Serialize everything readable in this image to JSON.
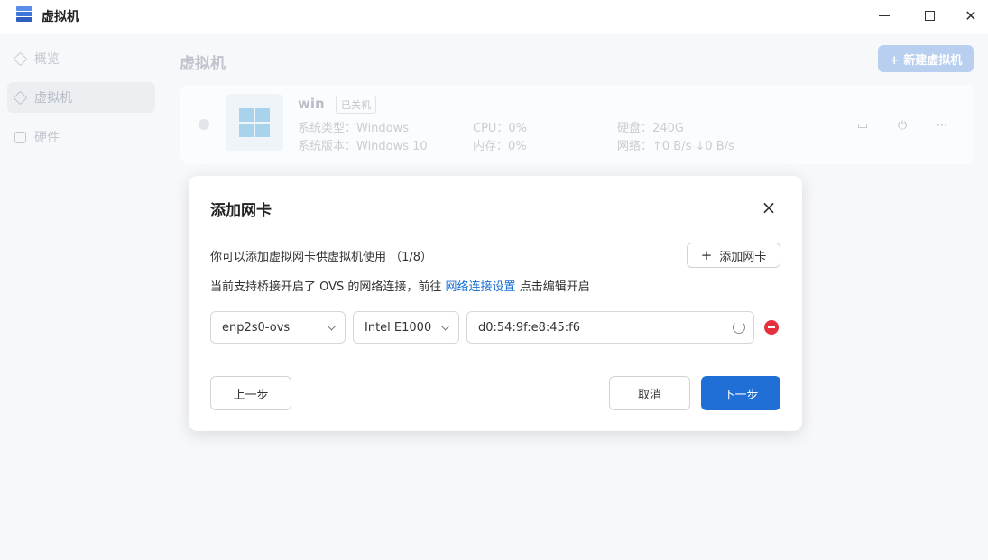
{
  "window": {
    "title": "虚拟机",
    "controls": [
      "minimize",
      "maximize",
      "close"
    ]
  },
  "sidebar": {
    "items": [
      {
        "label": "概览",
        "icon": "cube-icon",
        "active": false
      },
      {
        "label": "虚拟机",
        "icon": "cube-icon",
        "active": true
      },
      {
        "label": "硬件",
        "icon": "hardware-icon",
        "active": false
      }
    ]
  },
  "main": {
    "title": "虚拟机",
    "new_vm_label": "+ 新建虚拟机",
    "vm": {
      "name": "win",
      "status": "已关机",
      "os_type": "系统类型：Windows",
      "os_version": "系统版本：Windows 10",
      "cpu": "CPU：0%",
      "memory": "内存：0%",
      "disk": "硬盘：240G",
      "network": "网络：↑0 B/s  ↓0 B/s",
      "actions": [
        "monitor-icon",
        "power-icon",
        "more-icon"
      ]
    }
  },
  "modal": {
    "title": "添加网卡",
    "close_symbol": "×",
    "description": "你可以添加虚拟网卡供虚拟机使用 （1/8）",
    "bridge_prefix": "当前支持桥接开启了 OVS 的网络连接，前往 ",
    "bridge_link": "网络连接设置",
    "bridge_suffix": " 点击编辑开启",
    "add_nic_label": "添加网卡",
    "nic": {
      "interface": "enp2s0-ovs",
      "model": "Intel E1000",
      "mac": "d0:54:9f:e8:45:f6"
    },
    "buttons": {
      "prev": "上一步",
      "cancel": "取消",
      "next": "下一步"
    },
    "colors": {
      "primary": "#1f6fd6",
      "danger": "#e5303e",
      "link": "#1b6fd3"
    }
  }
}
